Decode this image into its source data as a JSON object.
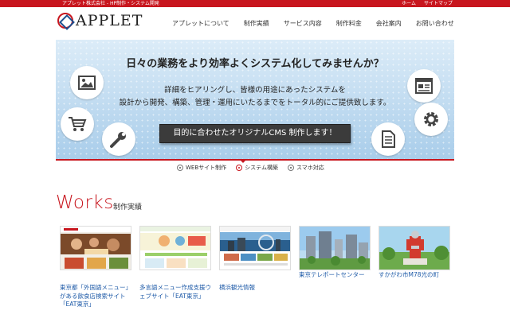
{
  "header": {
    "tagline": "アプレット株式会社 - HP制作・システム開発",
    "top_links": [
      "ホーム",
      "サイトマップ"
    ],
    "logo_text": "APPLET",
    "nav": [
      "アプレットについて",
      "制作実績",
      "サービス内容",
      "制作料金",
      "会社案内",
      "お問い合わせ"
    ]
  },
  "hero": {
    "title": "日々の業務をより効率よくシステム化してみませんか？",
    "lines": [
      "詳細をヒアリングし、皆様の用途にあったシステムを",
      "設計から開発、構築、管理・運用にいたるまでをトータル的にご提供致します。"
    ],
    "cta": "目的に合わせたオリジナルCMS 制作します！",
    "icons": [
      "image-icon",
      "cart-icon",
      "wrench-icon",
      "window-icon",
      "gear-icon",
      "document-icon"
    ]
  },
  "slider_tabs": [
    {
      "label": "WEBサイト制作",
      "active": false
    },
    {
      "label": "システム構築",
      "active": true
    },
    {
      "label": "スマホ対応",
      "active": false
    }
  ],
  "works": {
    "title": "Works",
    "subtitle": "制作実績",
    "items": [
      {
        "caption_lines": [
          "東京都「外国語メニュー」",
          "がある飲食店検索サイト",
          "「EAT東京」"
        ]
      },
      {
        "caption_lines": [
          "多言語メニュー作成支援ウ",
          "ェブサイト「EAT東京」"
        ]
      },
      {
        "caption_lines": [
          "横浜観光情報"
        ]
      },
      {
        "caption_lines": [
          "東京テレポートセンター"
        ]
      },
      {
        "caption_lines": [
          "すかがわ市M78光の町"
        ]
      }
    ]
  },
  "colors": {
    "brand_red": "#c8161e",
    "link_blue": "#1f5ba8",
    "hero_blue": "#a9cdea"
  }
}
